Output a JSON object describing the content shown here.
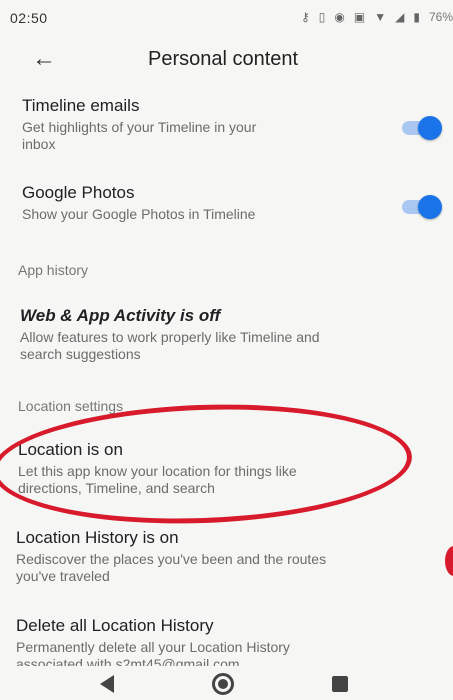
{
  "status_bar": {
    "time": "02:50",
    "battery": "76%"
  },
  "app_bar": {
    "title": "Personal content"
  },
  "rows": {
    "timeline_emails": {
      "title": "Timeline emails",
      "subtitle_line1": "Get highlights of your Timeline in your",
      "subtitle_line2": "inbox",
      "toggle_on": true
    },
    "google_photos": {
      "title": "Google Photos",
      "subtitle_line1": "Show your Google Photos in Timeline",
      "toggle_on": true
    },
    "web_app_activity": {
      "title": "Web & App Activity is off",
      "subtitle_line1": "Allow features to work properly like Timeline and",
      "subtitle_line2": "search suggestions"
    },
    "location": {
      "title": "Location is on",
      "subtitle_line1": "Let this app know your location for things like",
      "subtitle_line2": "directions, Timeline, and search"
    },
    "location_history": {
      "title": "Location History is on",
      "subtitle_line1": "Rediscover the places you've been and the routes",
      "subtitle_line2": "you've traveled"
    },
    "delete_history": {
      "title": "Delete all Location History",
      "subtitle_line1": "Permanently delete all your Location History",
      "subtitle_line2": "associated with s2mt45@gmail.com"
    }
  },
  "sections": {
    "app_history": "App history",
    "location_settings": "Location settings"
  },
  "colors": {
    "accent": "#1a73e8",
    "annotation": "#d81b2c"
  }
}
